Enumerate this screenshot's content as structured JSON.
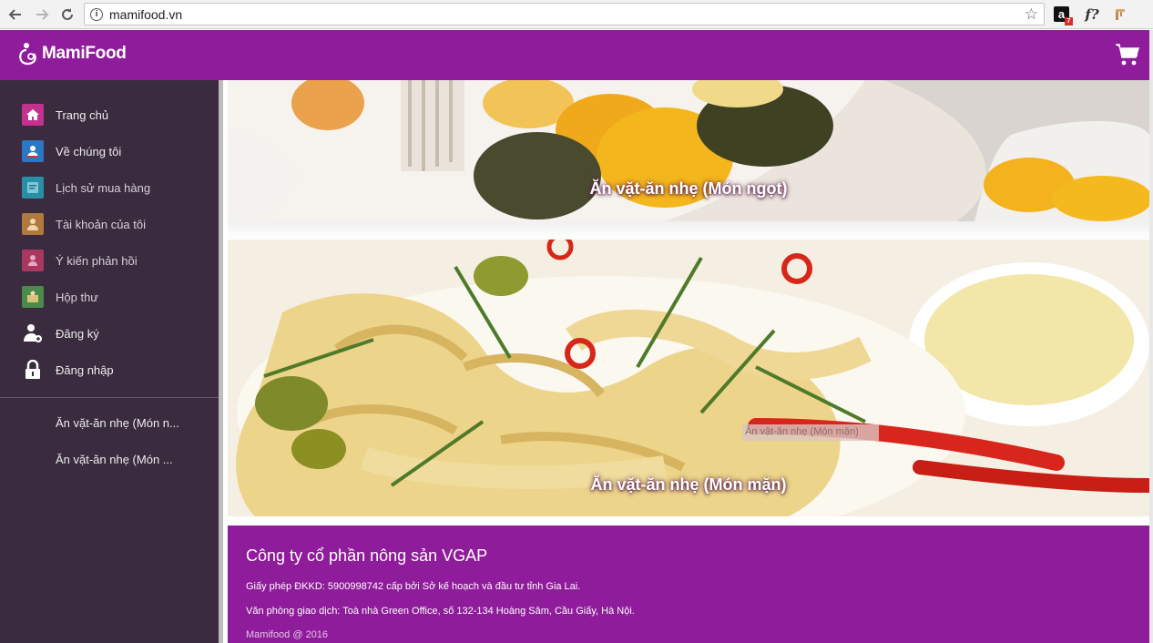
{
  "browser": {
    "url": "mamifood.vn",
    "extension_badge": "7",
    "ext_amazon_letter": "a",
    "ext_f_label": "f?"
  },
  "header": {
    "logo_text": "MamiFood"
  },
  "sidebar": {
    "items": [
      {
        "label": "Trang chủ",
        "icon": "home-icon",
        "color": "#c5318e"
      },
      {
        "label": "Về chúng tôi",
        "icon": "about-icon",
        "color": "#2b77c5"
      },
      {
        "label": "Lịch sử mua hàng",
        "icon": "history-icon",
        "color": "#2a8fa6"
      },
      {
        "label": "Tài khoản của tôi",
        "icon": "account-icon",
        "color": "#b07a3e"
      },
      {
        "label": "Ý kiến phản hồi",
        "icon": "feedback-icon",
        "color": "#a8385f"
      },
      {
        "label": "Hộp thư",
        "icon": "mailbox-icon",
        "color": "#4a8a4a"
      },
      {
        "label": "Đăng ký",
        "icon": "register-icon",
        "color": "none"
      },
      {
        "label": "Đăng nhập",
        "icon": "login-icon",
        "color": "none"
      }
    ],
    "categories": [
      "Ăn vặt-ăn nhẹ (Món n...",
      "Ăn vặt-ăn nhẹ (Món ..."
    ]
  },
  "banners": [
    {
      "caption": "Ăn vặt-ăn nhẹ (Món ngọt)"
    },
    {
      "caption": "Ăn vặt-ăn nhẹ (Món mặn)",
      "tooltip": "Ăn vặt-ăn nhẹ (Món mặn)"
    }
  ],
  "footer": {
    "company": "Công ty cổ phần nông sản VGAP",
    "license": "Giấy phép ĐKKD: 5900998742 cấp bởi Sở kế hoạch và đầu tư tỉnh Gia Lai.",
    "office": "Văn phòng giao dịch: Toà nhà Green Office, số 132-134 Hoàng Sâm, Cầu Giấy, Hà Nội.",
    "copyright": "Mamifood @ 2016"
  },
  "colors": {
    "brand": "#8f1c9a",
    "sidebar": "#3a2b3e"
  }
}
